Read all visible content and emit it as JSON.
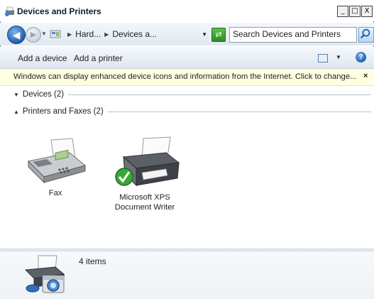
{
  "window": {
    "title": "Devices and Printers"
  },
  "caption_buttons": {
    "minimize": "_",
    "maximize": "□",
    "close": "X"
  },
  "address_bar": {
    "breadcrumbs": [
      "Hard...",
      "Devices a..."
    ],
    "search_placeholder": "Search Devices and Printers"
  },
  "command_bar": {
    "add_device": "Add a device",
    "add_printer": "Add a printer"
  },
  "info_bar": {
    "message": "Windows can display enhanced device icons and information from the Internet. Click to change...",
    "close": "×"
  },
  "groups": {
    "devices": {
      "label": "Devices (2)",
      "expanded": false
    },
    "printers": {
      "label": "Printers and Faxes (2)",
      "expanded": true
    }
  },
  "devices": [
    {
      "label": "Fax",
      "icon": "fax-icon",
      "default": false
    },
    {
      "label": "Microsoft XPS\nDocument Writer",
      "icon": "printer-icon",
      "default": true
    }
  ],
  "details": {
    "count": "4 items"
  },
  "colors": {
    "infobar_bg": "#ffffe1",
    "default_check": "#3aa53a"
  }
}
